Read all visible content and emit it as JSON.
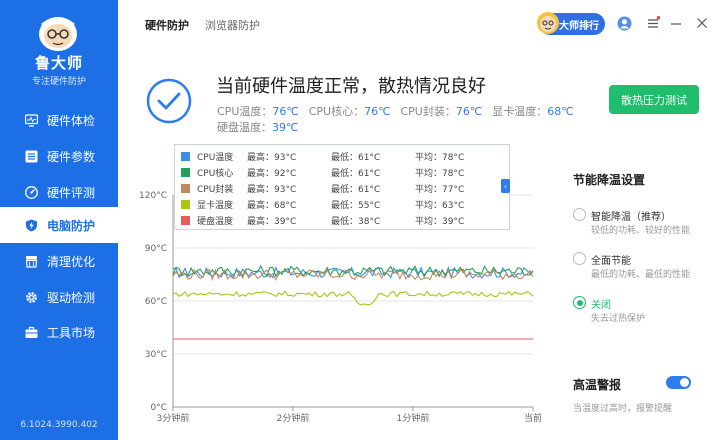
{
  "sidebar": {
    "app_name": "鲁大师",
    "app_subtitle": "专注硬件防护",
    "items": [
      {
        "label": "硬件体检",
        "icon": "monitor-icon"
      },
      {
        "label": "硬件参数",
        "icon": "list-icon"
      },
      {
        "label": "硬件评测",
        "icon": "gauge-icon"
      },
      {
        "label": "电脑防护",
        "icon": "shield-bolt-icon",
        "active": true
      },
      {
        "label": "清理优化",
        "icon": "broom-icon"
      },
      {
        "label": "驱动检测",
        "icon": "gear-icon"
      },
      {
        "label": "工具市场",
        "icon": "toolbox-icon"
      }
    ],
    "version": "6.1024.3990.402"
  },
  "tabs": [
    {
      "label": "硬件防护",
      "active": true
    },
    {
      "label": "浏览器防护",
      "active": false
    }
  ],
  "header": {
    "rank_button": "大师排行"
  },
  "status": {
    "title": "当前硬件温度正常，散热情况良好",
    "temps": [
      {
        "label": "CPU温度：",
        "value": "76℃"
      },
      {
        "label": "CPU核心：",
        "value": "76℃"
      },
      {
        "label": "CPU封装：",
        "value": "76℃"
      },
      {
        "label": "显卡温度：",
        "value": "68℃"
      },
      {
        "label": "硬盘温度：",
        "value": "39℃"
      }
    ],
    "stress_button": "散热压力测试"
  },
  "colors": {
    "sidebar": "#1d6fe6",
    "accent": "#2f7cf0",
    "green": "#1fbd6c"
  },
  "chart_data": {
    "type": "line",
    "x_ticks": [
      "3分钟前",
      "2分钟前",
      "1分钟前",
      "当前"
    ],
    "y_ticks": [
      "0°C",
      "30°C",
      "60°C",
      "90°C",
      "120°C"
    ],
    "ylim": [
      0,
      120
    ],
    "grid": true,
    "legend_position": "top",
    "series": [
      {
        "name": "CPU温度",
        "color": "#3d8ee0",
        "max": "最高：93°C",
        "min": "最低：61°C",
        "avg": "平均：78°C",
        "base": 76,
        "amp": 3
      },
      {
        "name": "CPU核心",
        "color": "#22a05a",
        "max": "最高：92°C",
        "min": "最低：61°C",
        "avg": "平均：78°C",
        "base": 77,
        "amp": 3
      },
      {
        "name": "CPU封装",
        "color": "#c08a5e",
        "max": "最高：93°C",
        "min": "最低：61°C",
        "avg": "平均：77°C",
        "base": 75,
        "amp": 3
      },
      {
        "name": "显卡温度",
        "color": "#aac418",
        "max": "最高：68°C",
        "min": "最低：55°C",
        "avg": "平均：63°C",
        "base": 64,
        "amp": 1.5
      },
      {
        "name": "硬盘温度",
        "color": "#e85a5a",
        "max": "最高：39°C",
        "min": "最低：38°C",
        "avg": "平均：39°C",
        "base": 38.5,
        "amp": 0
      }
    ]
  },
  "cooling": {
    "title": "节能降温设置",
    "options": [
      {
        "label": "智能降温（推荐）",
        "desc": "较低的功耗、较好的性能",
        "checked": false
      },
      {
        "label": "全面节能",
        "desc": "最低的功耗、最低的性能",
        "checked": false
      },
      {
        "label": "关闭",
        "desc": "失去过热保护",
        "checked": true
      }
    ]
  },
  "alarm": {
    "title": "高温警报",
    "desc": "当温度过高时，报警提醒",
    "enabled": true
  }
}
